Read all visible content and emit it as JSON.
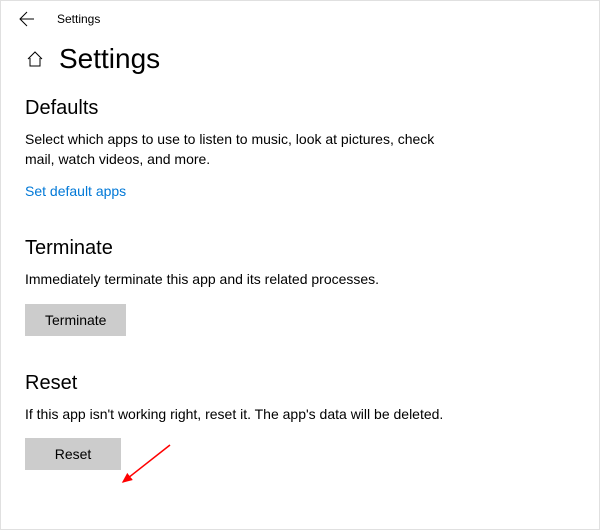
{
  "titlebar": {
    "title": "Settings"
  },
  "header": {
    "page_title": "Settings"
  },
  "sections": {
    "defaults": {
      "heading": "Defaults",
      "desc": "Select which apps to use to listen to music, look at pictures, check mail, watch videos, and more.",
      "link_label": "Set default apps"
    },
    "terminate": {
      "heading": "Terminate",
      "desc": "Immediately terminate this app and its related processes.",
      "button_label": "Terminate"
    },
    "reset": {
      "heading": "Reset",
      "desc": "If this app isn't working right, reset it. The app's data will be deleted.",
      "button_label": "Reset"
    }
  }
}
